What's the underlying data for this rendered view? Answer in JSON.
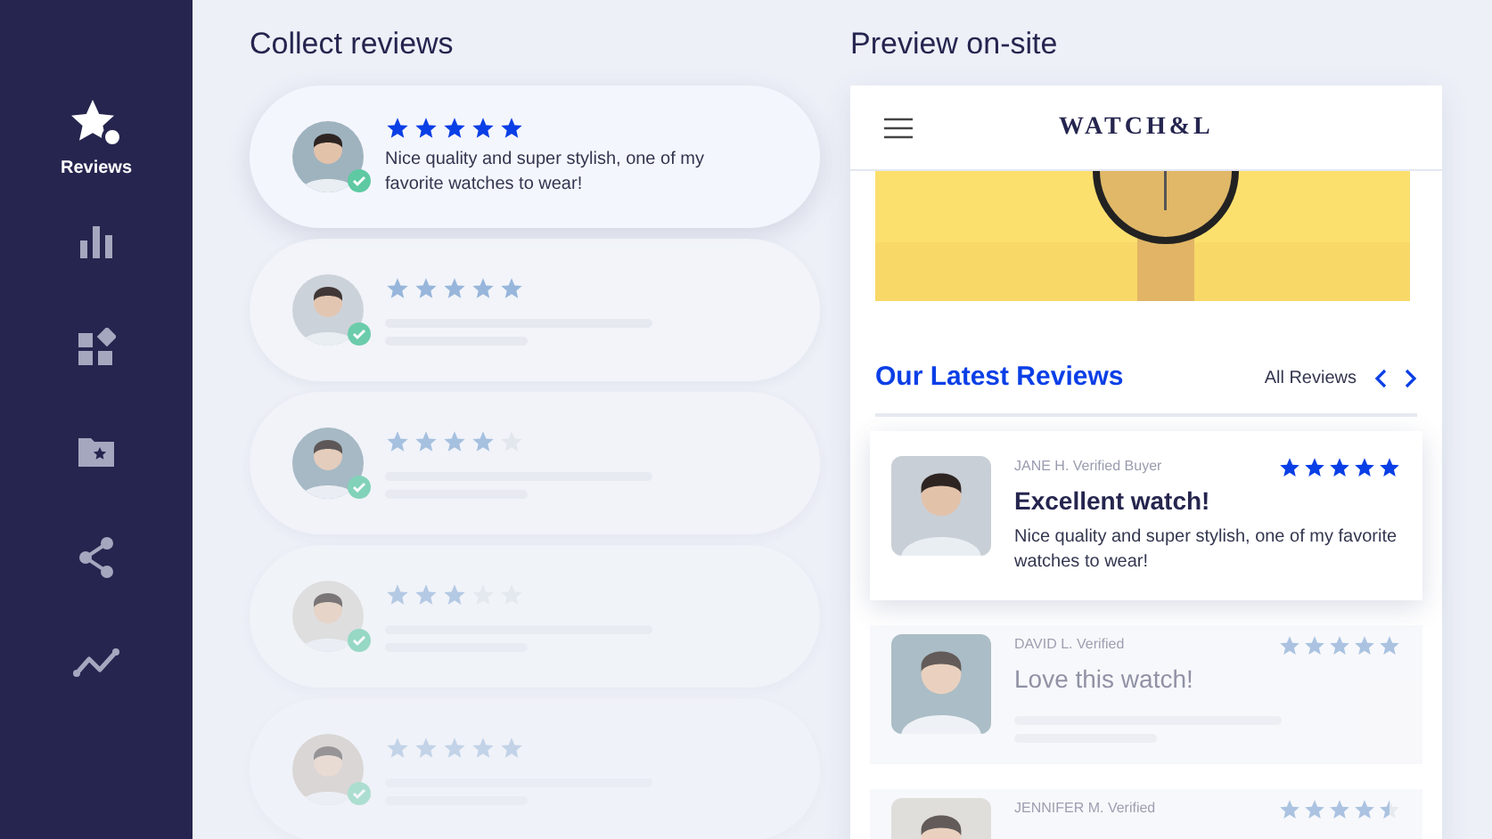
{
  "sidebar": {
    "items": [
      {
        "kind": "star",
        "label": "Reviews",
        "selected": true
      },
      {
        "kind": "chart",
        "selected": false
      },
      {
        "kind": "apps",
        "selected": false
      },
      {
        "kind": "folder",
        "selected": false
      },
      {
        "kind": "share",
        "selected": false
      },
      {
        "kind": "trend",
        "selected": false
      }
    ]
  },
  "collect": {
    "title": "Collect reviews",
    "cards": [
      {
        "stars": 5,
        "selected": true,
        "text": "Nice quality and super stylish, one of my favorite watches to wear!"
      },
      {
        "stars": 5,
        "selected": false
      },
      {
        "stars": 4,
        "selected": false
      },
      {
        "stars": 3,
        "selected": false
      },
      {
        "stars": 5,
        "selected": false
      }
    ]
  },
  "preview": {
    "title": "Preview on-site",
    "logo": "WATCH&L",
    "section_title": "Our Latest Reviews",
    "all_link": "All Reviews",
    "reviews": [
      {
        "author": "JANE H. Verified Buyer",
        "title": "Excellent watch!",
        "text": "Nice quality and super stylish, one of my favorite watches to wear!",
        "stars": 5,
        "selected": true
      },
      {
        "author": "DAVID L. Verified",
        "title": "Love this watch!",
        "stars": 5,
        "selected": false
      },
      {
        "author": "JENNIFER M. Verified",
        "stars": 4.5,
        "selected": false
      }
    ]
  }
}
